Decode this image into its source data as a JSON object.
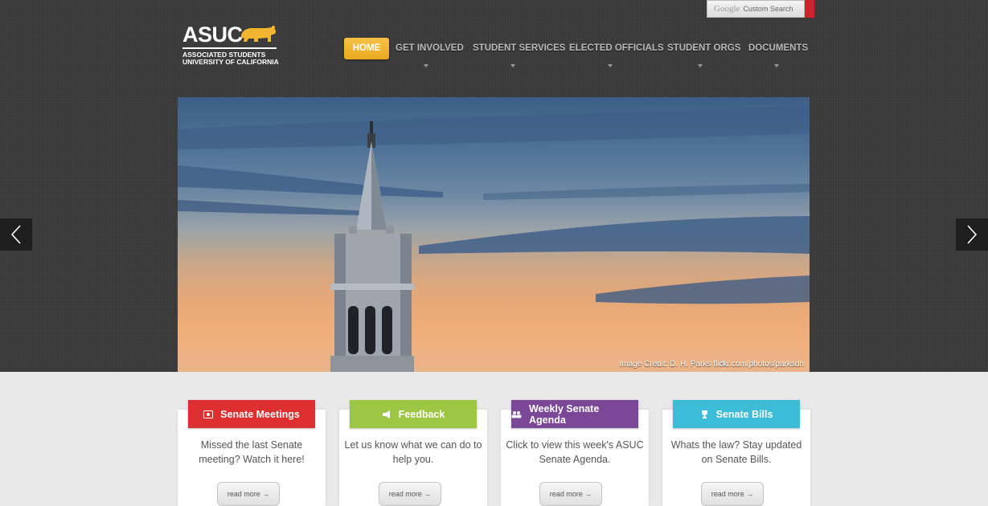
{
  "search": {
    "brand": "Google",
    "label": "Custom Search"
  },
  "logo": {
    "word": "ASUC",
    "sub1": "ASSOCIATED STUDENTS",
    "sub2": "UNIVERSITY OF CALIFORNIA"
  },
  "nav": [
    {
      "label": "HOME",
      "active": true
    },
    {
      "label": "GET INVOLVED"
    },
    {
      "label": "STUDENT SERVICES"
    },
    {
      "label": "ELECTED OFFICIALS"
    },
    {
      "label": "STUDENT ORGS"
    },
    {
      "label": "DOCUMENTS"
    }
  ],
  "hero": {
    "credit": "Image Credit: D. H. Parks flickr.com/photos/parksdh"
  },
  "cards": [
    {
      "title": "Senate Meetings",
      "icon": "video-icon",
      "color": "#dd2f2f",
      "line1": "Missed the last Senate",
      "line2": "meeting? Watch it here!",
      "button": "read more →"
    },
    {
      "title": "Feedback",
      "icon": "megaphone-icon",
      "color": "#9dc743",
      "line1": "Let us know what we can do to",
      "line2": "help you.",
      "button": "read more →"
    },
    {
      "title": "Weekly Senate Agenda",
      "icon": "group-icon",
      "color": "#7b4797",
      "line1": "Click to view this week's ASUC",
      "line2": "Senate Agenda.",
      "button": "read more →"
    },
    {
      "title": "Senate Bills",
      "icon": "trophy-icon",
      "color": "#3cbcd6",
      "line1": "Whats the law? Stay updated",
      "line2": "on Senate Bills.",
      "button": "read more →"
    }
  ],
  "colors": {
    "accent": "#f0b130",
    "header_bg": "#3a3a3a",
    "search_button": "#c8252c"
  }
}
